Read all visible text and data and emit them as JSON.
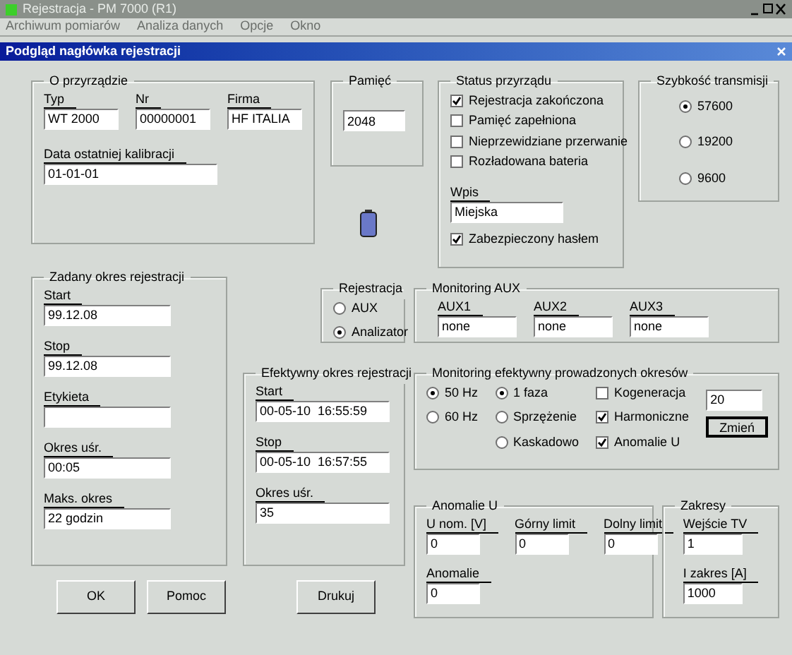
{
  "window": {
    "title": "Rejestracja - PM 7000 (R1)",
    "menu": [
      "Archiwum pomiarów",
      "Analiza danych",
      "Opcje",
      "Okno"
    ]
  },
  "dialog": {
    "title": "Podgląd nagłówka rejestracji"
  },
  "device": {
    "title": "O przyrządzie",
    "rows": [
      [
        {
          "label": "Typ",
          "value": "WT 2000"
        },
        {
          "label": "Nr",
          "value": "00000001"
        },
        {
          "label": "Firma",
          "value": "HF ITALIA"
        }
      ],
      [
        {
          "label": "Data ostatniej kalibracji",
          "value": "01-01-01"
        }
      ]
    ]
  },
  "memory": {
    "title": "Pamięć",
    "value": "2048"
  },
  "status": {
    "title": "Status przyrządu",
    "checks": [
      {
        "label": "Rejestracja zakończona",
        "checked": true
      },
      {
        "label": "Pamięć zapełniona",
        "checked": false
      },
      {
        "label": "Nieprzewidziane przerwanie",
        "checked": false
      },
      {
        "label": "Rozładowana bateria",
        "checked": false
      }
    ],
    "entry": {
      "label": "Wpis",
      "value": "Miejska"
    },
    "password": {
      "label": "Zabezpieczony hasłem",
      "checked": true
    }
  },
  "baud": {
    "title": "Szybkość transmisji",
    "options": [
      {
        "label": "57600",
        "selected": true
      },
      {
        "label": "19200",
        "selected": false
      },
      {
        "label": "9600",
        "selected": false
      }
    ]
  },
  "planned": {
    "title": "Zadany okres rejestracji",
    "rows": [
      [
        {
          "label": "Start",
          "value": "99.12.08"
        }
      ],
      [
        {
          "label": "Stop",
          "value": "99.12.08"
        }
      ],
      [
        {
          "label": "Etykieta"
        }
      ],
      [
        {
          "label": "Okres uśr.",
          "value": "00:05"
        }
      ],
      [
        {
          "label": "Maks. okres",
          "value": "22 godzin"
        }
      ]
    ]
  },
  "registration": {
    "title": "Rejestracja",
    "options": [
      {
        "label": "AUX",
        "selected": false
      },
      {
        "label": "Analizator",
        "selected": true
      }
    ]
  },
  "aux": {
    "title": "Monitoring AUX",
    "rows": [
      [
        {
          "label": "AUX1",
          "value": "none"
        },
        {
          "label": "AUX2",
          "value": "none"
        },
        {
          "label": "AUX3",
          "value": "none"
        }
      ]
    ]
  },
  "effective": {
    "title": "Efektywny okres rejestracji",
    "rows": [
      [
        {
          "label": "Start",
          "value": "00-05-10  16:55:59"
        }
      ],
      [
        {
          "label": "Stop",
          "value": "00-05-10  16:57:55"
        }
      ],
      [
        {
          "label": "Okres uśr.",
          "value": "35"
        }
      ]
    ]
  },
  "monitoring": {
    "title": "Monitoring efektywny prowadzonych okresów",
    "frequency": [
      {
        "label": "50 Hz",
        "selected": true
      },
      {
        "label": "60 Hz",
        "selected": false
      }
    ],
    "phases": [
      {
        "label": "1 faza",
        "selected": true
      },
      {
        "label": "Sprzężenie",
        "selected": false
      },
      {
        "label": "Kaskadowo",
        "selected": false
      }
    ],
    "checks": [
      {
        "label": "Kogeneracja",
        "checked": false
      },
      {
        "label": "Harmoniczne",
        "checked": true
      },
      {
        "label": "Anomalie U",
        "checked": true
      }
    ],
    "value": "20",
    "button": "Zmień"
  },
  "anomalies": {
    "title": "Anomalie U",
    "rows": [
      [
        {
          "label": "U nom. [V]",
          "value": "0"
        },
        {
          "label": "Górny limit",
          "value": "0"
        },
        {
          "label": "Dolny limit",
          "value": "0"
        }
      ],
      [
        {
          "label": "Anomalie",
          "value": "0"
        }
      ]
    ]
  },
  "ranges": {
    "title": "Zakresy",
    "rows": [
      [
        {
          "label": "Wejście TV",
          "value": "1"
        }
      ],
      [
        {
          "label": "I zakres [A]",
          "value": "1000"
        }
      ]
    ]
  },
  "buttons": [
    "OK",
    "Pomoc",
    "Drukuj"
  ]
}
